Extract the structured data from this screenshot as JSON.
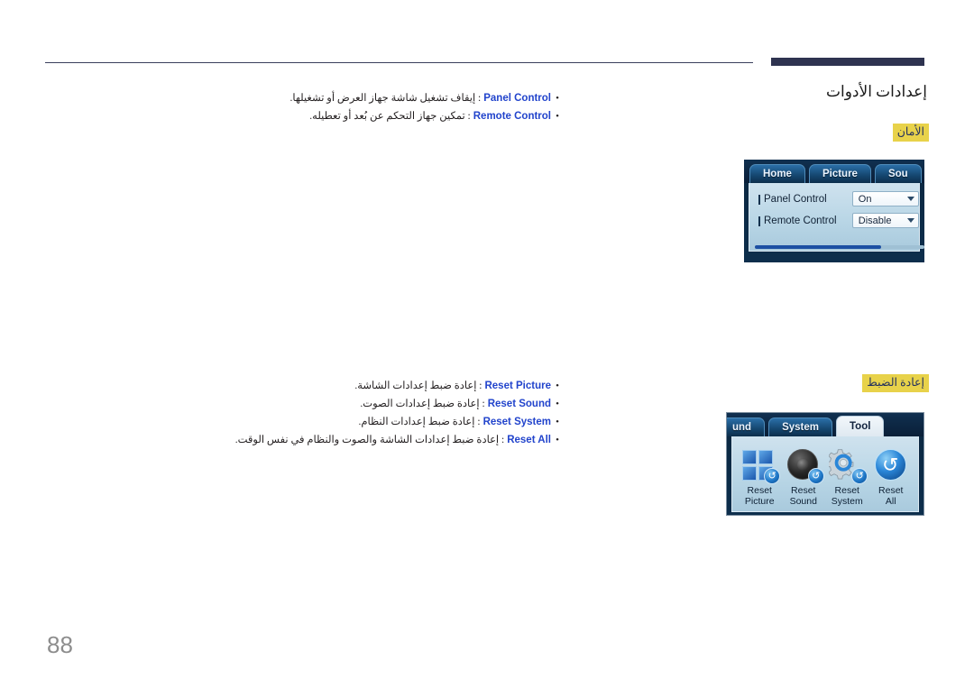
{
  "document": {
    "page_number": "88",
    "title": "إعدادات الأدوات"
  },
  "sections": [
    {
      "id": "security",
      "heading": "الأمان",
      "bullets": [
        {
          "dot": "•",
          "term": "Panel Control",
          "desc": ": إيقاف تشغيل شاشة جهاز العرض أو تشغيلها."
        },
        {
          "dot": "•",
          "term": "Remote Control",
          "desc": ": تمكين جهاز التحكم عن بُعد أو تعطيله."
        }
      ],
      "osd": {
        "tabs": [
          {
            "label": "Home",
            "active": false
          },
          {
            "label": "Picture",
            "active": false
          },
          {
            "label": "Sou",
            "active": false
          }
        ],
        "rows": [
          {
            "label": "Panel Control",
            "value": "On"
          },
          {
            "label": "Remote Control",
            "value": "Disable"
          }
        ]
      }
    },
    {
      "id": "reset",
      "heading": "إعادة الضبط",
      "bullets": [
        {
          "dot": "•",
          "term": "Reset Picture",
          "desc": ": إعادة ضبط إعدادات الشاشة."
        },
        {
          "dot": "•",
          "term": "Reset Sound",
          "desc": ": إعادة ضبط إعدادات الصوت."
        },
        {
          "dot": "•",
          "term": "Reset System",
          "desc": ": إعادة ضبط إعدادات النظام."
        },
        {
          "dot": "•",
          "term": "Reset All",
          "desc": ": إعادة ضبط إعدادات الشاشة والصوت والنظام في نفس الوقت."
        }
      ],
      "osd": {
        "tabs": [
          {
            "label": "und",
            "active": false
          },
          {
            "label": "System",
            "active": false
          },
          {
            "label": "Tool",
            "active": true
          }
        ],
        "items": [
          {
            "line1": "Reset",
            "line2": "Picture",
            "icon": "reset-picture-icon"
          },
          {
            "line1": "Reset",
            "line2": "Sound",
            "icon": "reset-sound-icon"
          },
          {
            "line1": "Reset",
            "line2": "System",
            "icon": "reset-system-icon"
          },
          {
            "line1": "Reset",
            "line2": "All",
            "icon": "reset-all-icon"
          }
        ]
      }
    }
  ],
  "colors": {
    "rule": "#3a3f5c",
    "bar": "#2e3350",
    "highlight": "#e8d24a",
    "term": "#2244cc",
    "heading_text": "#24315f"
  }
}
